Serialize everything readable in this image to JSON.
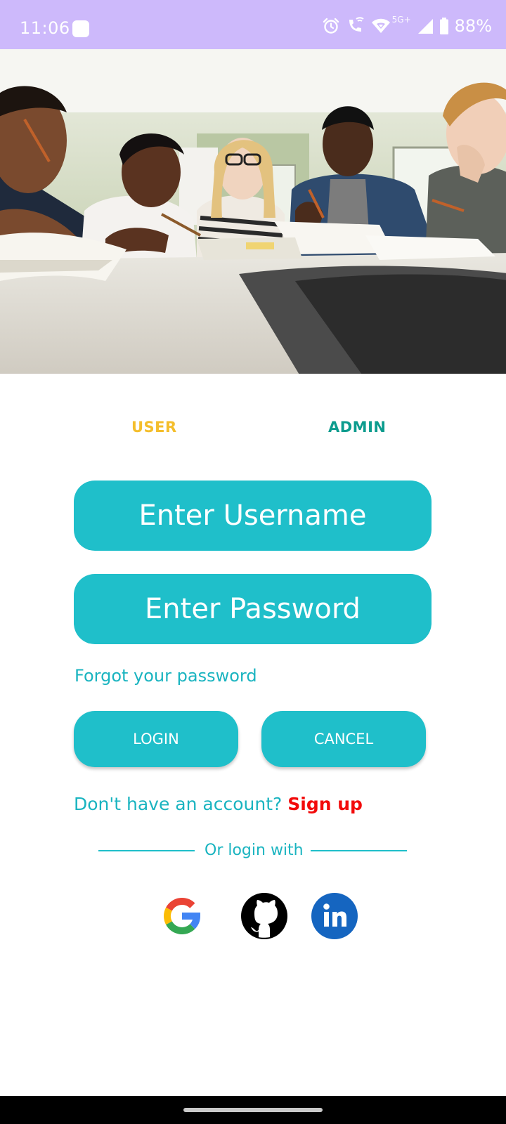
{
  "status_bar": {
    "time": "11:06",
    "network_label": "5G+",
    "battery": "88%",
    "icons": [
      "app-notification-icon",
      "alarm-icon",
      "wifi-calling-icon",
      "wifi-icon",
      "signal-icon",
      "battery-icon"
    ]
  },
  "hero": {
    "image": "students studying together at a table"
  },
  "tabs": {
    "user": "USER",
    "admin": "ADMIN"
  },
  "form": {
    "username_placeholder": "Enter Username",
    "password_placeholder": "Enter Password",
    "forgot_password": "Forgot your password",
    "login_label": "LOGIN",
    "cancel_label": "CANCEL",
    "no_account_text": "Don't have an account?",
    "signup_label": "Sign up",
    "divider_text": "Or login with"
  },
  "social": {
    "icons": [
      "google-icon",
      "github-icon",
      "linkedin-icon"
    ]
  },
  "colors": {
    "status_bar": "#cdb9fb",
    "accent": "#1fbfca",
    "accent_text": "#1ab4c0",
    "tab_user": "#f4be2c",
    "tab_admin": "#0c9c8e",
    "signup": "#f20a0a"
  }
}
